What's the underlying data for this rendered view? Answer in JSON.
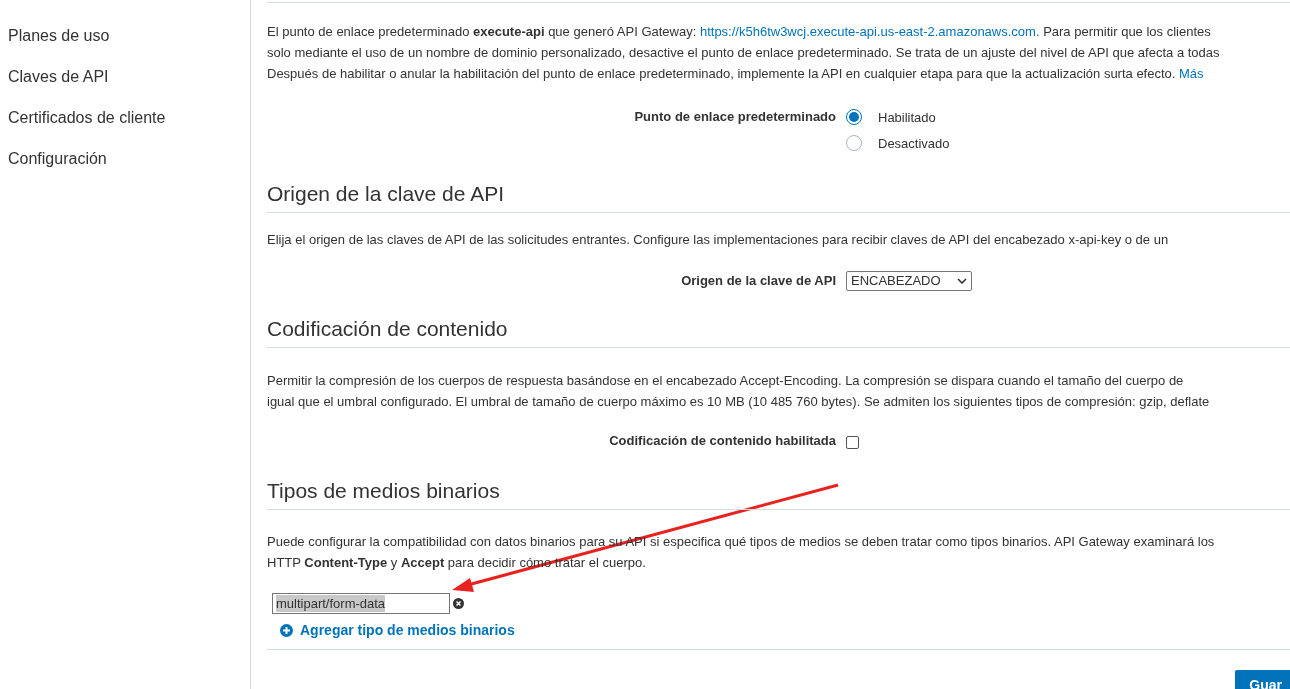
{
  "sidebar": {
    "items": [
      {
        "label": "Planes de uso",
        "selected": false
      },
      {
        "label": "Claves de API",
        "selected": false
      },
      {
        "label": "Certificados de cliente",
        "selected": false
      },
      {
        "label": "Configuración",
        "selected": false
      }
    ]
  },
  "endpoint": {
    "lines": [
      {
        "text": "El punto de enlace predeterminado **execute-api** que generó API Gateway: ",
        "link": "https://k5h6tw3wcj.execute-api.us-east-2.amazonaws.com.",
        "after": " Para permitir que los clientes"
      },
      {
        "text": "solo mediante el uso de un nombre de dominio personalizado, desactive el punto de enlace predeterminado. Se trata de un ajuste del nivel de API que afecta a todas"
      },
      {
        "text": "Después de habilitar o anular la habilitación del punto de enlace predeterminado, implemente la API en cualquier etapa para que la actualización surta efecto. ",
        "link": "Más"
      }
    ],
    "label": "Punto de enlace predeterminado",
    "options": [
      {
        "label": "Habilitado",
        "selected": true
      },
      {
        "label": "Desactivado",
        "selected": false
      }
    ]
  },
  "api_key_source": {
    "heading": "Origen de la clave de API",
    "lines": [
      "Elija el origen de las claves de API de las solicitudes entrantes. Configure las implementaciones para recibir claves de API del encabezado x-api-key o de un"
    ],
    "label": "Origen de la clave de API",
    "value": "ENCABEZADO"
  },
  "content_encoding": {
    "heading": "Codificación de contenido",
    "lines": [
      "Permitir la compresión de los cuerpos de respuesta basándose en el encabezado Accept-Encoding. La compresión se dispara cuando el tamaño del cuerpo de",
      "igual que el umbral configurado. El umbral de tamaño de cuerpo máximo es 10 MB (10 485 760 bytes). Se admiten los siguientes tipos de compresión: gzip, deflate"
    ],
    "label": "Codificación de contenido habilitada",
    "checked": false
  },
  "binary_media": {
    "heading": "Tipos de medios binarios",
    "lines": [
      "Puede configurar la compatibilidad con datos binarios para su API si especifica qué tipos de medios se deben tratar como tipos binarios. API Gateway examinará los",
      "HTTP **Content-Type** y **Accept** para decidir cómo tratar el cuerpo."
    ],
    "types": [
      {
        "value": "multipart/form-data",
        "highlighted": true
      }
    ],
    "add_link": "Agregar tipo de medios binarios"
  },
  "save_button": "Guar"
}
